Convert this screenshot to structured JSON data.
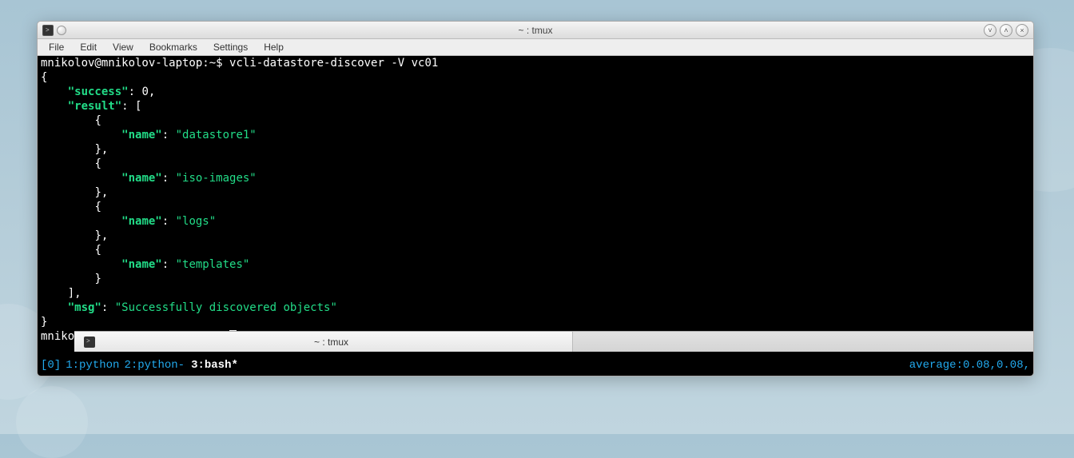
{
  "window": {
    "title": "~ : tmux"
  },
  "menu": {
    "file": "File",
    "edit": "Edit",
    "view": "View",
    "bookmarks": "Bookmarks",
    "settings": "Settings",
    "help": "Help"
  },
  "terminal": {
    "prompt1_user": "mnikolov@mnikolov-laptop",
    "prompt1_path": "~",
    "prompt1_sep": ":",
    "prompt1_end": "$",
    "command1": "vcli-datastore-discover -V vc01",
    "json": {
      "open": "{",
      "success_key": "\"success\"",
      "success_val": "0",
      "result_key": "\"result\"",
      "result_open": "[",
      "items": [
        {
          "name_key": "\"name\"",
          "name_val": "\"datastore1\""
        },
        {
          "name_key": "\"name\"",
          "name_val": "\"iso-images\""
        },
        {
          "name_key": "\"name\"",
          "name_val": "\"logs\""
        },
        {
          "name_key": "\"name\"",
          "name_val": "\"templates\""
        }
      ],
      "result_close": "]",
      "msg_key": "\"msg\"",
      "msg_val": "\"Successfully discovered objects\"",
      "close": "}"
    },
    "prompt2_user": "mnikolov@mnikolov-laptop",
    "prompt2_path": "~",
    "prompt2_sep": ":",
    "prompt2_end": "$"
  },
  "tmux": {
    "session": "[0]",
    "win1": "1:python",
    "win2": "2:python-",
    "win3": "3:bash*",
    "avg": "average:0.08,0.08,"
  },
  "taskbar": {
    "item1": "~ : tmux"
  }
}
